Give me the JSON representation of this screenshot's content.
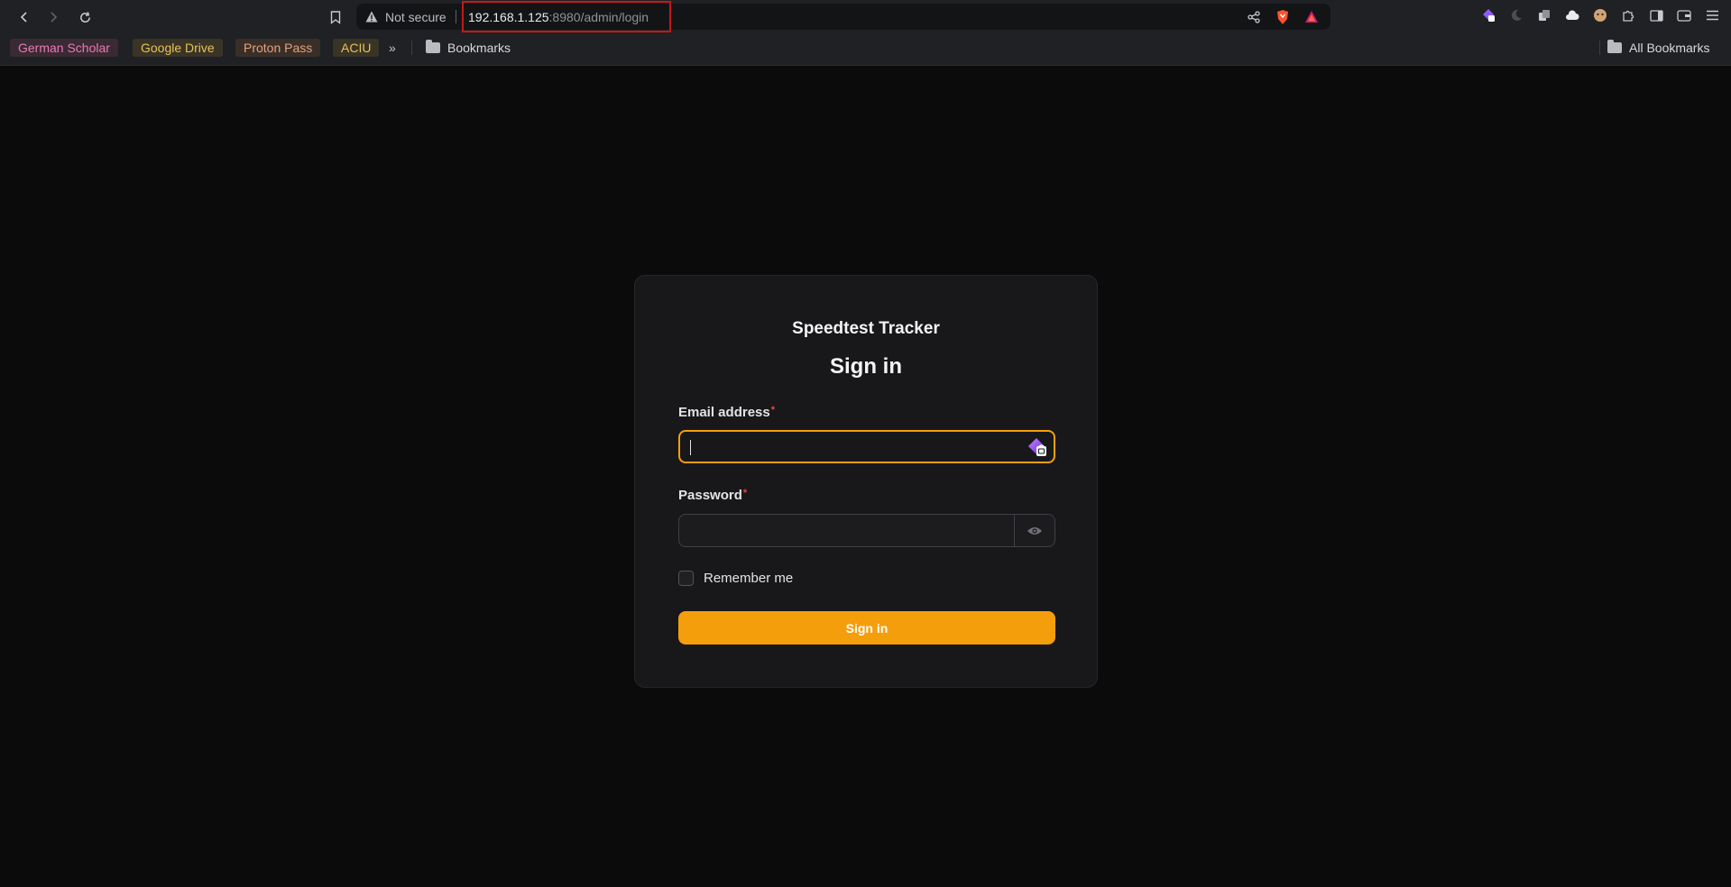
{
  "browser": {
    "security_label": "Not secure",
    "url_host": "192.168.1.125",
    "url_rest": ":8980/admin/login",
    "bookmarks": [
      {
        "label": "German Scholar",
        "color": "#e879b6",
        "bg": "#3a2a33"
      },
      {
        "label": "Google Drive",
        "color": "#e6c15a",
        "bg": "#3a3426"
      },
      {
        "label": "Proton Pass",
        "color": "#e3a37a",
        "bg": "#3a2f28"
      },
      {
        "label": "ACIU",
        "color": "#e6c15a",
        "bg": "#3a3426"
      }
    ],
    "overflow_label": "»",
    "folder_label": "Bookmarks",
    "all_bookmarks_label": "All Bookmarks"
  },
  "login": {
    "brand": "Speedtest Tracker",
    "heading": "Sign in",
    "email_label": "Email address",
    "password_label": "Password",
    "required_mark": "*",
    "remember_label": "Remember me",
    "submit_label": "Sign in",
    "accent_color": "#f59e0b"
  }
}
